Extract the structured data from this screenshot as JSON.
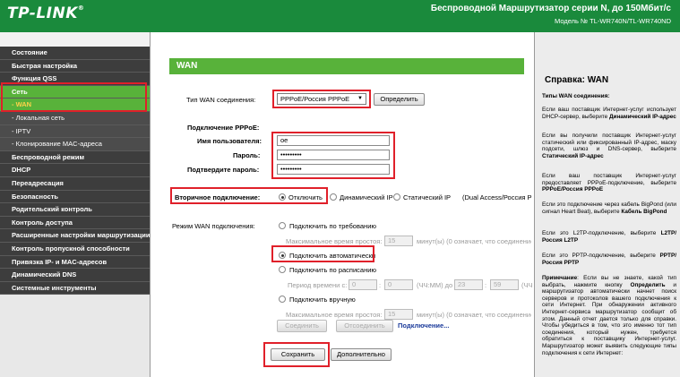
{
  "header": {
    "brand": "TP-LINK",
    "brand_mark": "®",
    "title": "Беспроводной Маршрутизатор серии N, до 150Мбит/с",
    "model": "Модель № TL-WR740N/TL-WR740ND",
    "bg_color": "#1a8a3c"
  },
  "sidebar": {
    "items": [
      {
        "label": "Состояние"
      },
      {
        "label": "Быстрая настройка"
      },
      {
        "label": "Функция QSS"
      },
      {
        "label": "Сеть"
      },
      {
        "label": "- WAN"
      },
      {
        "label": "- Локальная сеть"
      },
      {
        "label": "- IPTV"
      },
      {
        "label": "- Клонирование MAC-адреса"
      },
      {
        "label": "Беспроводной режим"
      },
      {
        "label": "DHCP"
      },
      {
        "label": "Переадресация"
      },
      {
        "label": "Безопасность"
      },
      {
        "label": "Родительский контроль"
      },
      {
        "label": "Контроль доступа"
      },
      {
        "label": "Расширенные настройки маршрутизации"
      },
      {
        "label": "Контроль пропускной способности"
      },
      {
        "label": "Привязка IP- и MAC-адресов"
      },
      {
        "label": "Динамический DNS"
      },
      {
        "label": "Системные инструменты"
      }
    ],
    "active_color": "#58b23a"
  },
  "main": {
    "section_title": "WAN",
    "conn_type_label": "Тип WAN соединения:",
    "conn_type_value": "PPPoE/Россия PPPoE",
    "detect_button": "Определить",
    "pppoe_label": "Подключение PPPoE:",
    "username_label": "Имя пользователя:",
    "username_value": "oe",
    "password_label": "Пароль:",
    "password_value": "•••••••••",
    "confirm_label": "Подтвердите пароль:",
    "confirm_value": "•••••••••",
    "secondary_label": "Вторичное подключение:",
    "secondary_options": [
      "Отключить",
      "Динамический IP",
      "Статический IP",
      "(Dual Access/Россия P"
    ],
    "mode_label": "Режим WAN подключения:",
    "mode_on_demand": "Подключить по требованию",
    "max_idle_label": "Максимальное время простоя:",
    "max_idle_value": "15",
    "max_idle_unit": "минут(ы) (0 означает, что соединение",
    "mode_auto": "Подключить автоматически",
    "mode_schedule": "Подключить по расписанию",
    "period_label": "Период времени с:",
    "period_from_h": "0",
    "period_from_m": "0",
    "period_unit": "(ЧЧ:ММ) до",
    "period_to_h": "23",
    "period_to_m": "59",
    "period_unit2": "(ЧЧ",
    "mode_manual": "Подключить вручную",
    "max_idle2_label": "Максимальное время простоя:",
    "max_idle2_value": "15",
    "max_idle2_unit": "минут(ы) (0 означает, что соединение",
    "connect_button": "Соединить",
    "disconnect_button": "Отсоединить",
    "status_link": "Подключение...",
    "save_button": "Сохранить",
    "advanced_button": "Дополнительно"
  },
  "help": {
    "title": "Справка: WAN",
    "p1": "Типы WAN соединения:",
    "p2a": "Если ваш поставщик Интернет-услуг использует DHCP-сервер, выберите ",
    "p2b": "Динамический IP-адрес",
    "p3a": "Если вы получили поставщик Интернет-услуг статический или фиксированный IP-адрес, маску подсети, шлюз и DNS-сервер, выберите ",
    "p3b": "Статический IP-адрес",
    "p4a": "Если ваш поставщик Интернет-услуг предоставляет PPPoE-подключение, выберите ",
    "p4b": "PPPoE/Россия PPPoE",
    "p5a": "Если это подключение через кабель BigPond (или сигнал Heart Beat), выберите ",
    "p5b": "Кабель BigPond",
    "p6a": "Если это L2TP-подключение, выберите ",
    "p6b": "L2TP/Россия L2TP",
    "p7a": "Если это PPTP-подключение, выберите ",
    "p7b": "PPTP/Россия PPTP",
    "p8a": "Примечание",
    "p8b": ": Если вы не знаете, какой тип выбрать, нажмите кнопку ",
    "p8c": "Определить",
    "p8d": " и маршрутизатор автоматически начнет поиск серверов и протоколов вашего подключения к сети Интернет. При обнаружении активного Интернет-сервиса маршрутизатор сообщит об этом. Данный отчет дается только для справки. Чтобы убедиться в том, что это именно тот тип соединения, который нужен, требуется обратиться к поставщику Интернет-услуг. Маршрутизатор может выявить следующие типы подключения к сети Интернет:"
  }
}
